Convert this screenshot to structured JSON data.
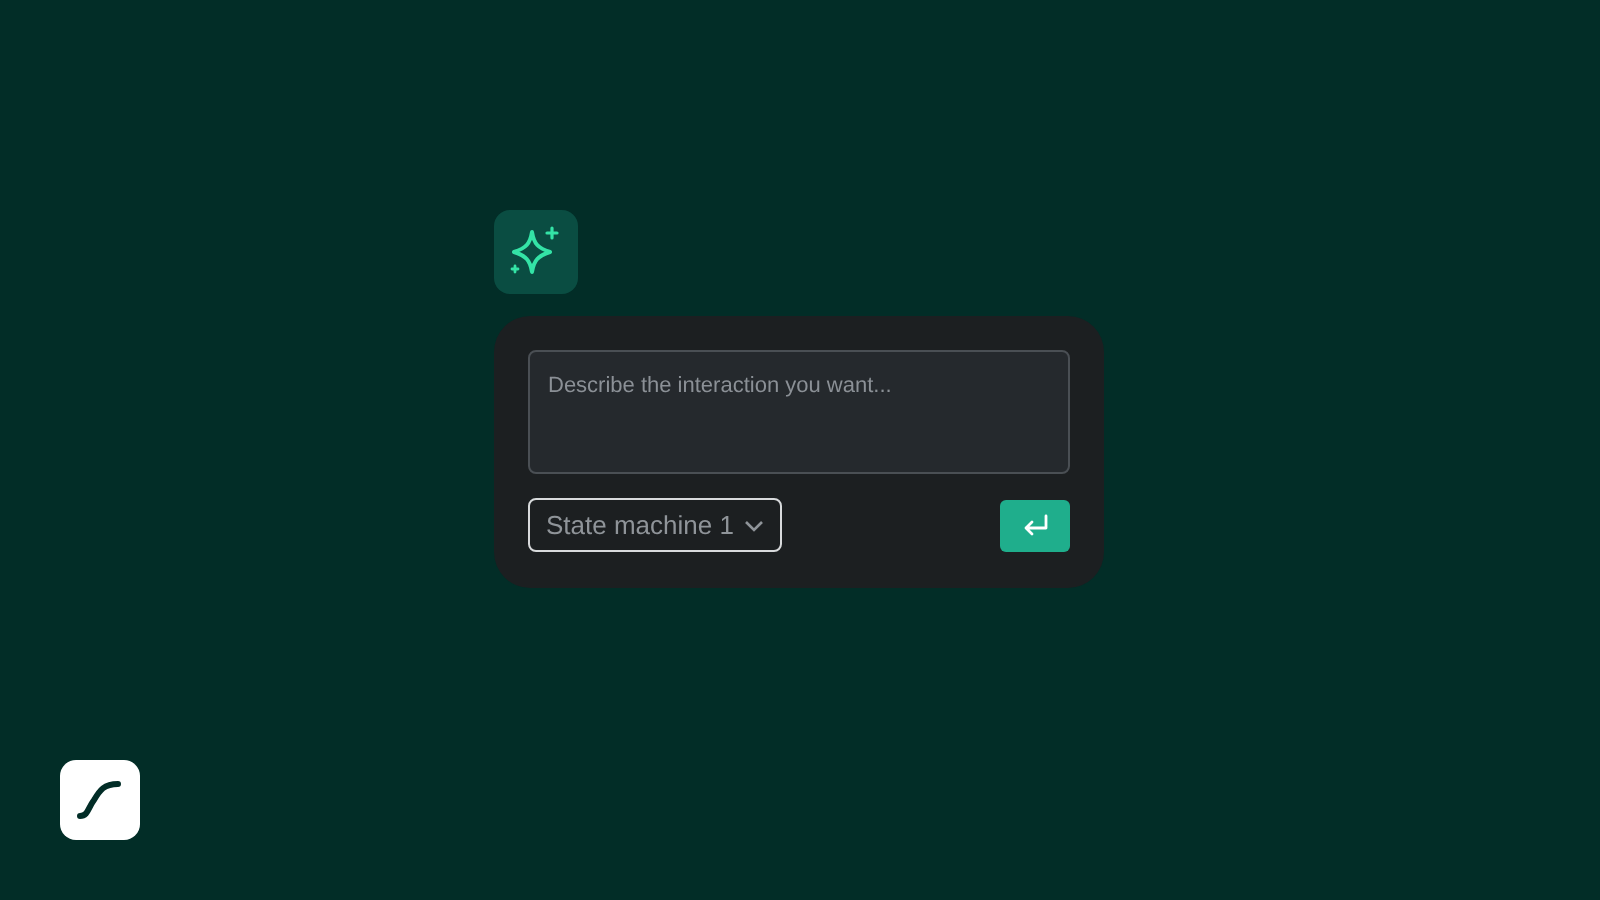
{
  "prompt": {
    "placeholder": "Describe the interaction you want..."
  },
  "state_machine_select": {
    "value": "State machine 1"
  }
}
